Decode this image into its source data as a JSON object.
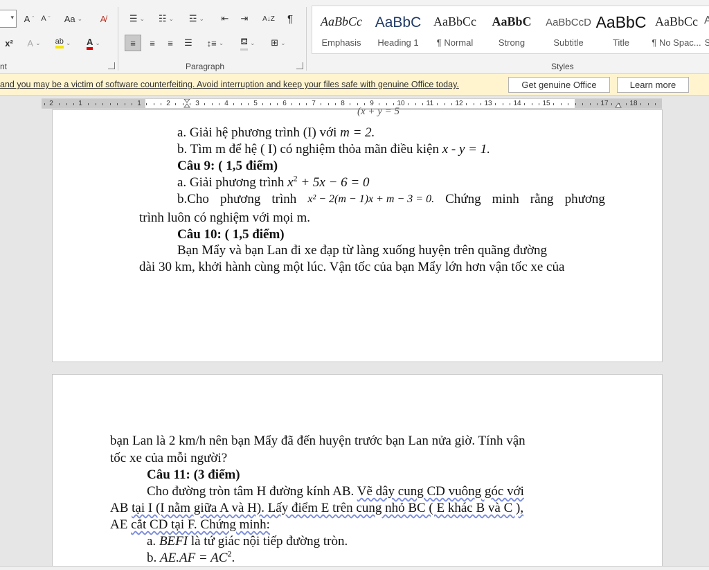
{
  "ribbon": {
    "font_group": {
      "grow_label": "A",
      "shrink_label": "A",
      "case_label": "Aa",
      "superscript_label": "x²",
      "effects_label": "A",
      "highlight_label": "ab",
      "color_label": "A",
      "group_label": "nt"
    },
    "paragraph_group": {
      "label": "Paragraph",
      "sort_label": "A↓Z",
      "pilcrow_label": "¶"
    },
    "styles_group": {
      "label": "Styles",
      "items": [
        {
          "sample": "AaBbCc",
          "name": "Emphasis"
        },
        {
          "sample": "AaBbC",
          "name": "Heading 1"
        },
        {
          "sample": "AaBbCc",
          "name": "¶ Normal"
        },
        {
          "sample": "AaBbC",
          "name": "Strong"
        },
        {
          "sample": "AaBbCcD",
          "name": "Subtitle"
        },
        {
          "sample": "AaBbC",
          "name": "Title"
        },
        {
          "sample": "AaBbCc",
          "name": "¶ No Spac..."
        },
        {
          "sample": "A",
          "name": "S"
        }
      ]
    }
  },
  "notification": {
    "text": "and you may be a victim of software counterfeiting. Avoid interruption and keep your files safe with genuine Office today.",
    "primary_button": "Get genuine Office",
    "secondary_button": "Learn more"
  },
  "ruler": {
    "numbers": [
      "2",
      "1",
      "1",
      "2",
      "3",
      "4",
      "5",
      "6",
      "7",
      "8",
      "9",
      "10",
      "11",
      "12",
      "13",
      "14",
      "15",
      "17",
      "18"
    ]
  },
  "document": {
    "page1": {
      "cut_top": "(x + y = 5",
      "l1_pre": "a. Giải hệ phương trình (I) với ",
      "l1_math": "m = 2.",
      "l2_pre": "b. Tìm m để hệ ( I) có nghiệm thỏa mãn điều kiện ",
      "l2_math": "x - y = 1.",
      "q9": "Câu 9: ( 1,5 điểm)",
      "l3_pre": "a. Giải phương trình ",
      "l3_math_a": "x",
      "l3_math_sup": "2",
      "l3_math_b": " + 5x − 6 = 0",
      "l4_a": "b.Cho",
      "l4_b": "phương",
      "l4_c": "trình",
      "l4_math": "x² − 2(m − 1)x + m − 3 = 0.",
      "l4_d": "Chứng",
      "l4_e": "minh",
      "l4_f": "rằng",
      "l4_g": "phương",
      "l5": "trình luôn có nghiệm với mọi m.",
      "q10": "Câu 10: ( 1,5 điểm)",
      "l6": "Bạn Mẩy  và bạn Lan đi xe đạp từ làng xuống huyện  trên quãng đường",
      "l7": "dài 30 km, khởi hành cùng một lúc. Vận tốc của bạn Mẩy lớn hơn vận tốc xe của"
    },
    "page2": {
      "l1": "bạn Lan là 2 km/h nên bạn Mẩy đã đến huyện trước bạn Lan nửa giờ. Tính vận",
      "l2": "tốc xe của mỗi người?",
      "q11": "Câu 11: (3 điểm)",
      "l3_pre": "Cho đường tròn tâm H đường kính AB. ",
      "l3_sq": "Vẽ dây cung CD vuông góc với",
      "l4_pre": "AB ",
      "l4_sq": "tại I (I nằm giữa A và H). Lấy điểm E trên cung nhỏ BC ( E khác B và C ),",
      "l5_a": "AE ",
      "l5_sq": "cắt CD tại F. Chứng minh:",
      "l6_pre": "a. ",
      "l6_math": "BEFI",
      "l6_post": " là tứ giác nội tiếp đường tròn.",
      "l7_pre": "b. ",
      "l7_math_a": "AE.AF = AC",
      "l7_sup": "2",
      "l7_post": "."
    }
  }
}
